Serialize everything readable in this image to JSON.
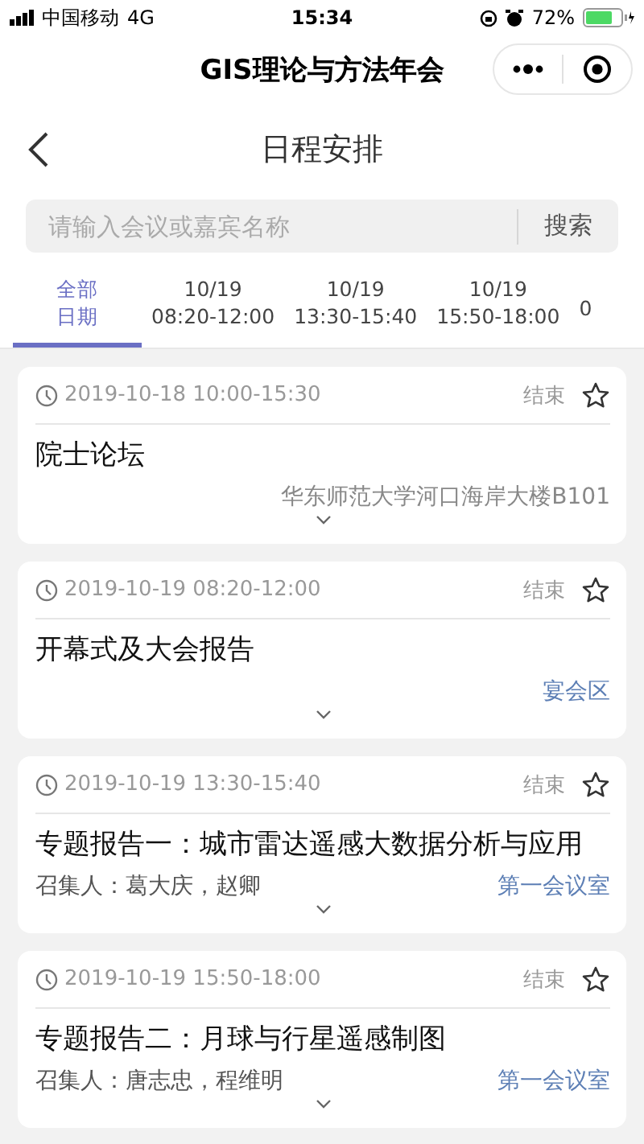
{
  "status_bar": {
    "carrier": "中国移动",
    "network": "4G",
    "time": "15:34",
    "battery": "72%"
  },
  "app_header": {
    "title": "GIS理论与方法年会"
  },
  "nav": {
    "title": "日程安排"
  },
  "search": {
    "placeholder": "请输入会议或嘉宾名称",
    "button": "搜索"
  },
  "tabs": [
    {
      "date": "全部",
      "time": "日期",
      "selected": true
    },
    {
      "date": "10/19",
      "time": "08:20-12:00",
      "selected": false
    },
    {
      "date": "10/19",
      "time": "13:30-15:40",
      "selected": false
    },
    {
      "date": "10/19",
      "time": "15:50-18:00",
      "selected": false
    },
    {
      "time": "0",
      "selected": false
    }
  ],
  "sessions": [
    {
      "time": "2019-10-18 10:00-15:30",
      "status": "结束",
      "starred": false,
      "title": "院士论坛",
      "location": "华东师范大学河口海岸大楼B101",
      "location_linked": false
    },
    {
      "time": "2019-10-19 08:20-12:00",
      "status": "结束",
      "starred": false,
      "title": "开幕式及大会报告",
      "location": "宴会区",
      "location_linked": true
    },
    {
      "time": "2019-10-19 13:30-15:40",
      "status": "结束",
      "starred": false,
      "title": "专题报告一：城市雷达遥感大数据分析与应用",
      "convener": "召集人：葛大庆，赵卿",
      "location": "第一会议室",
      "location_linked": true
    },
    {
      "time": "2019-10-19 15:50-18:00",
      "status": "结束",
      "starred": false,
      "title": "专题报告二：月球与行星遥感制图",
      "convener": "召集人：唐志忠，程维明",
      "location": "第一会议室",
      "location_linked": true
    }
  ]
}
